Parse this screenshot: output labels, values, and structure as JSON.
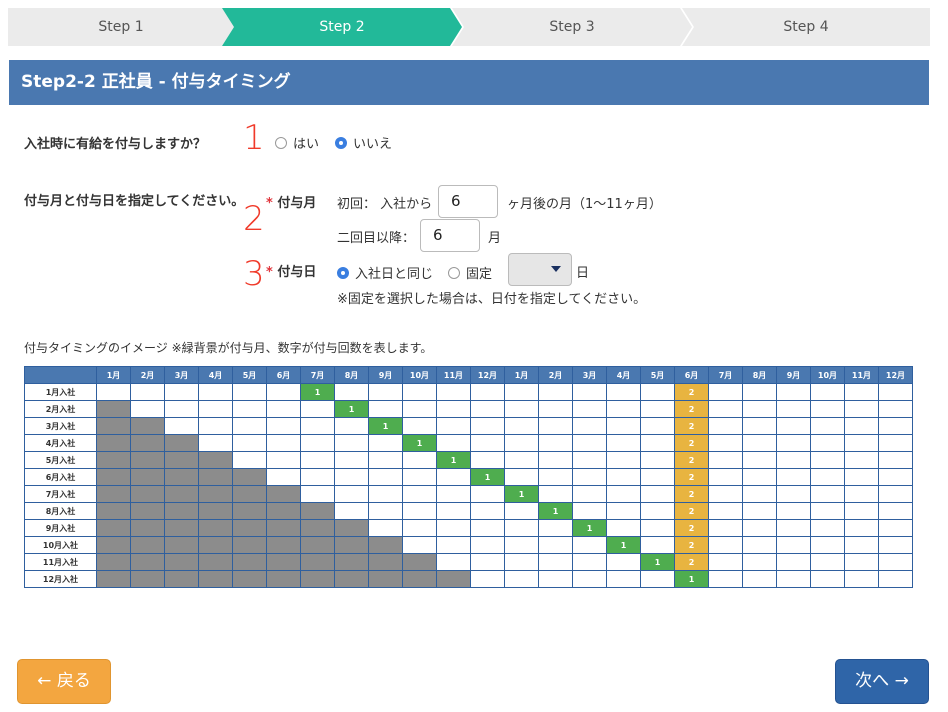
{
  "stepper": {
    "steps": [
      {
        "label": "Step 1",
        "active": false
      },
      {
        "label": "Step 2",
        "active": true
      },
      {
        "label": "Step 3",
        "active": false
      },
      {
        "label": "Step 4",
        "active": false
      }
    ],
    "active_color": "#22b999",
    "inactive_color": "#ebebeb"
  },
  "section": {
    "title": "Step2-2 正社員 - 付与タイミング"
  },
  "annotations": {
    "n1": "1",
    "n2": "2",
    "n3": "3"
  },
  "q1": {
    "label": "入社時に有給を付与しますか？",
    "options": [
      "はい",
      "いいえ"
    ],
    "selected": "いいえ"
  },
  "q2": {
    "label": "付与月と付与日を指定してください。",
    "required_mark": "*",
    "grant_month": {
      "label": "付与月",
      "first_prefix": "初回：  入社から",
      "first_value": "6",
      "first_suffix": "ヶ月後の月（1〜11ヶ月）",
      "second_prefix": "二回目以降：",
      "second_value": "6",
      "second_suffix": "月"
    },
    "grant_day": {
      "label": "付与日",
      "options": [
        "入社日と同じ",
        "固定"
      ],
      "selected": "入社日と同じ",
      "select_value": "",
      "select_suffix": "日",
      "note": "※固定を選択した場合は、日付を指定してください。"
    }
  },
  "image_caption": "付与タイミングのイメージ ※緑背景が付与月、数字が付与回数を表します。",
  "timeline": {
    "months": [
      "1月",
      "2月",
      "3月",
      "4月",
      "5月",
      "6月",
      "7月",
      "8月",
      "9月",
      "10月",
      "11月",
      "12月",
      "1月",
      "2月",
      "3月",
      "4月",
      "5月",
      "6月",
      "7月",
      "8月",
      "9月",
      "10月",
      "11月",
      "12月"
    ],
    "rows": [
      {
        "label": "1月入社",
        "cells": [
          "",
          "",
          "",
          "",
          "",
          "",
          "1",
          "",
          "",
          "",
          "",
          "",
          "",
          "",
          "",
          "",
          "",
          "2",
          "",
          "",
          "",
          "",
          "",
          ""
        ]
      },
      {
        "label": "2月入社",
        "cells": [
          "X",
          "",
          "",
          "",
          "",
          "",
          "",
          "1",
          "",
          "",
          "",
          "",
          "",
          "",
          "",
          "",
          "",
          "2",
          "",
          "",
          "",
          "",
          "",
          ""
        ]
      },
      {
        "label": "3月入社",
        "cells": [
          "X",
          "X",
          "",
          "",
          "",
          "",
          "",
          "",
          "1",
          "",
          "",
          "",
          "",
          "",
          "",
          "",
          "",
          "2",
          "",
          "",
          "",
          "",
          "",
          ""
        ]
      },
      {
        "label": "4月入社",
        "cells": [
          "X",
          "X",
          "X",
          "",
          "",
          "",
          "",
          "",
          "",
          "1",
          "",
          "",
          "",
          "",
          "",
          "",
          "",
          "2",
          "",
          "",
          "",
          "",
          "",
          ""
        ]
      },
      {
        "label": "5月入社",
        "cells": [
          "X",
          "X",
          "X",
          "X",
          "",
          "",
          "",
          "",
          "",
          "",
          "1",
          "",
          "",
          "",
          "",
          "",
          "",
          "2",
          "",
          "",
          "",
          "",
          "",
          ""
        ]
      },
      {
        "label": "6月入社",
        "cells": [
          "X",
          "X",
          "X",
          "X",
          "X",
          "",
          "",
          "",
          "",
          "",
          "",
          "1",
          "",
          "",
          "",
          "",
          "",
          "2",
          "",
          "",
          "",
          "",
          "",
          ""
        ]
      },
      {
        "label": "7月入社",
        "cells": [
          "X",
          "X",
          "X",
          "X",
          "X",
          "X",
          "",
          "",
          "",
          "",
          "",
          "",
          "1",
          "",
          "",
          "",
          "",
          "2",
          "",
          "",
          "",
          "",
          "",
          ""
        ]
      },
      {
        "label": "8月入社",
        "cells": [
          "X",
          "X",
          "X",
          "X",
          "X",
          "X",
          "X",
          "",
          "",
          "",
          "",
          "",
          "",
          "1",
          "",
          "",
          "",
          "2",
          "",
          "",
          "",
          "",
          "",
          ""
        ]
      },
      {
        "label": "9月入社",
        "cells": [
          "X",
          "X",
          "X",
          "X",
          "X",
          "X",
          "X",
          "X",
          "",
          "",
          "",
          "",
          "",
          "",
          "1",
          "",
          "",
          "2",
          "",
          "",
          "",
          "",
          "",
          ""
        ]
      },
      {
        "label": "10月入社",
        "cells": [
          "X",
          "X",
          "X",
          "X",
          "X",
          "X",
          "X",
          "X",
          "X",
          "",
          "",
          "",
          "",
          "",
          "",
          "1",
          "",
          "2",
          "",
          "",
          "",
          "",
          "",
          ""
        ]
      },
      {
        "label": "11月入社",
        "cells": [
          "X",
          "X",
          "X",
          "X",
          "X",
          "X",
          "X",
          "X",
          "X",
          "X",
          "",
          "",
          "",
          "",
          "",
          "",
          "1",
          "2",
          "",
          "",
          "",
          "",
          "",
          ""
        ]
      },
      {
        "label": "12月入社",
        "cells": [
          "X",
          "X",
          "X",
          "X",
          "X",
          "X",
          "X",
          "X",
          "X",
          "X",
          "X",
          "",
          "",
          "",
          "",
          "",
          "",
          "1",
          "",
          "",
          "",
          "",
          "",
          ""
        ]
      }
    ],
    "colors": {
      "header": "#4a78b0",
      "past": "#8c8c8c",
      "first_grant": "#4fad4f",
      "second_grant": "#e8b440"
    }
  },
  "footer": {
    "back_label": "← 戻る",
    "next_label": "次へ →"
  }
}
